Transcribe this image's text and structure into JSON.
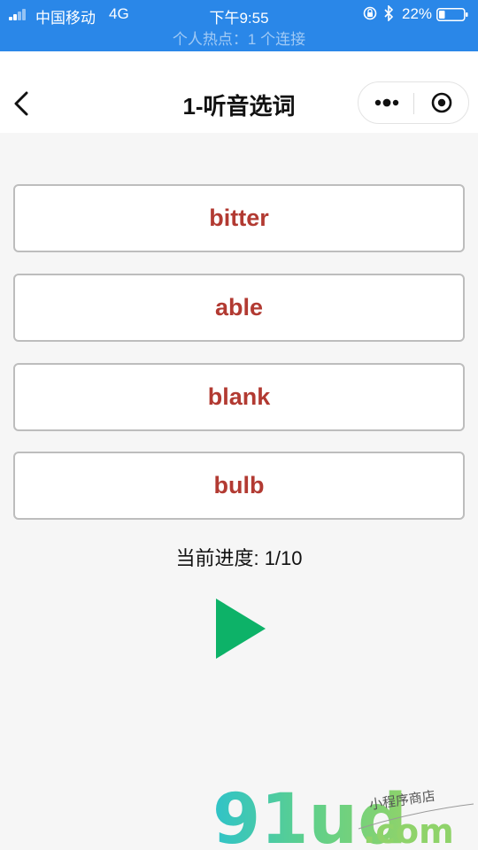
{
  "status_bar": {
    "carrier": "中国移动",
    "network": "4G",
    "time": "下午9:55",
    "battery": "22%",
    "hotspot": "个人热点：1 个连接"
  },
  "nav": {
    "title": "1-听音选词"
  },
  "options": [
    "bitter",
    "able",
    "blank",
    "bulb"
  ],
  "progress": {
    "label": "当前进度: 1/10",
    "current": 1,
    "total": 10
  },
  "watermark": {
    "brand": "91ud",
    "domain": ".com",
    "tagline": "小程序商店"
  },
  "colors": {
    "status_bar": "#2a87e8",
    "option_text": "#b23a32",
    "play": "#0db268",
    "background": "#f6f6f6"
  }
}
